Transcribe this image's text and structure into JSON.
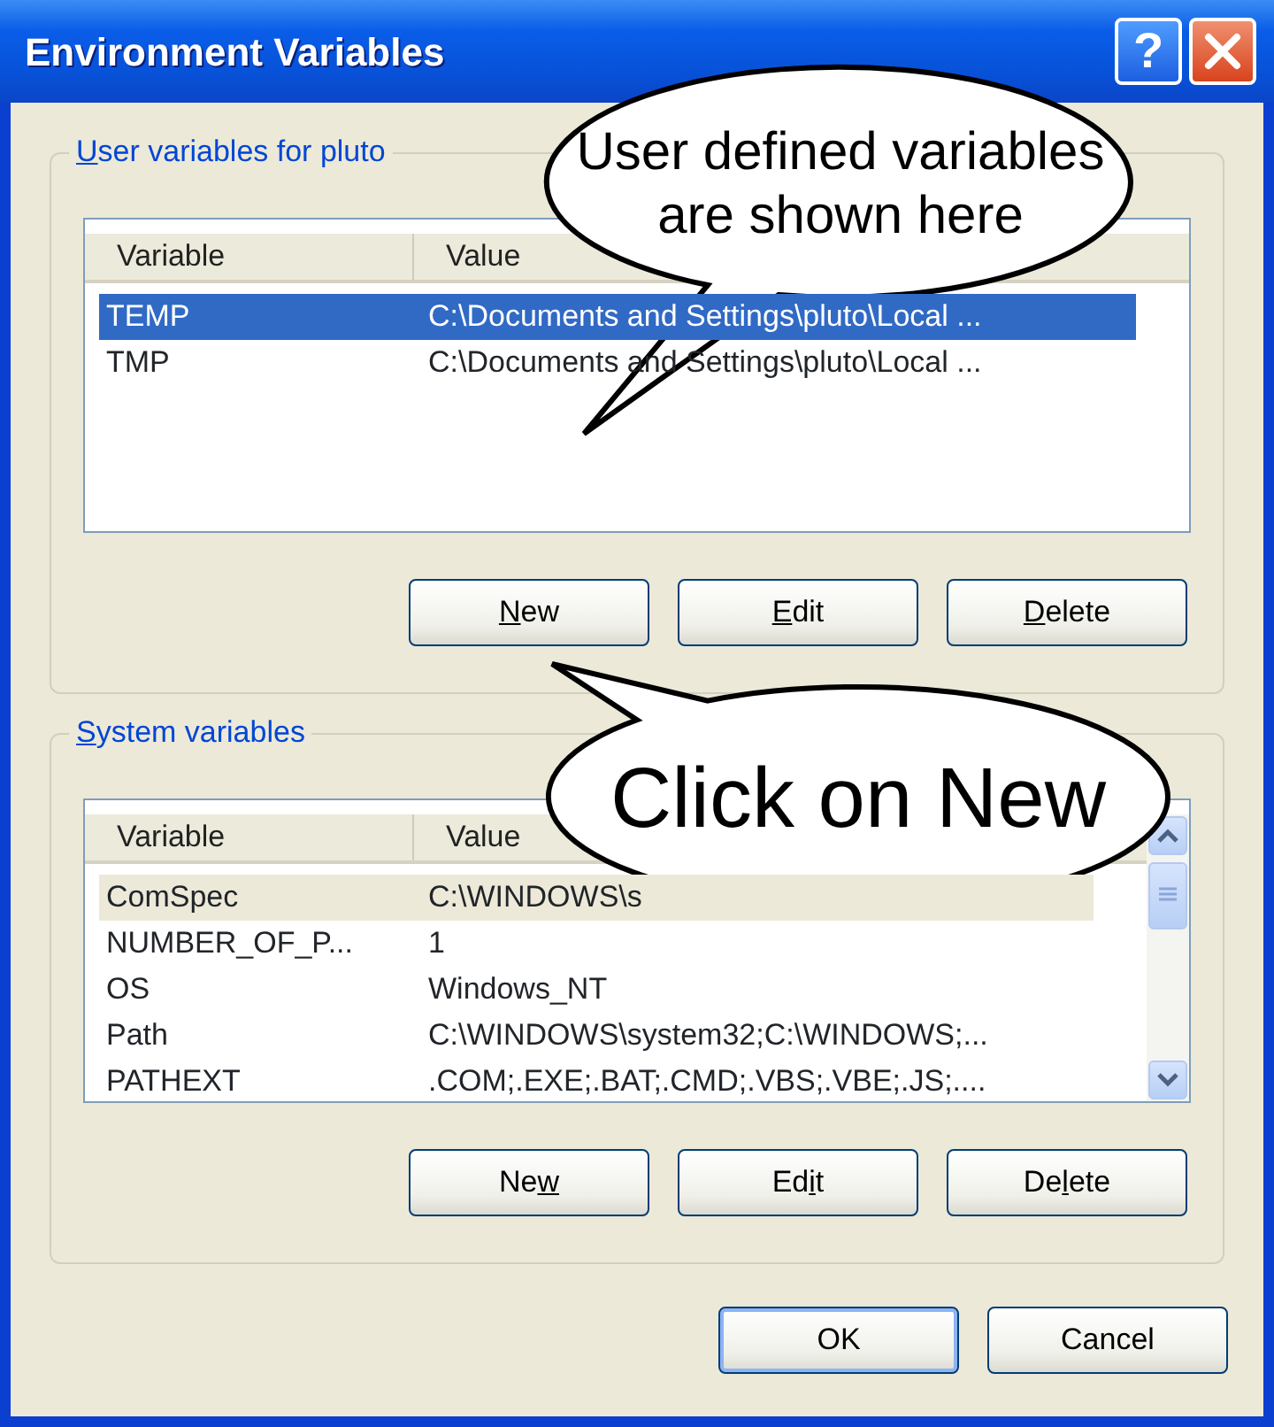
{
  "window": {
    "title": "Environment Variables",
    "title_buttons": [
      {
        "kind": "help",
        "label": "?"
      },
      {
        "kind": "close"
      }
    ]
  },
  "groups": [
    {
      "label": {
        "key": "U",
        "post": "ser variables for pluto"
      },
      "list": {
        "focused": true,
        "scrollbar": false,
        "columns": [
          "Variable",
          "Value"
        ],
        "rows": [
          {
            "variable": "TEMP",
            "value": "C:\\Documents and Settings\\pluto\\Local ...",
            "selected": true
          },
          {
            "variable": "TMP",
            "value": "C:\\Documents and Settings\\pluto\\Local ...",
            "selected": false
          }
        ]
      },
      "buttons": [
        {
          "label": {
            "key": "N",
            "post": "ew"
          }
        },
        {
          "label": {
            "key": "E",
            "post": "dit"
          }
        },
        {
          "label": {
            "key": "D",
            "post": "elete"
          }
        }
      ]
    },
    {
      "label": {
        "key": "S",
        "post": "ystem variables"
      },
      "list": {
        "focused": false,
        "scrollbar": true,
        "columns": [
          "Variable",
          "Value"
        ],
        "rows": [
          {
            "variable": "ComSpec",
            "value": "C:\\WINDOWS\\s",
            "selected": true
          },
          {
            "variable": "NUMBER_OF_P...",
            "value": "1",
            "selected": false
          },
          {
            "variable": "OS",
            "value": "Windows_NT",
            "selected": false
          },
          {
            "variable": "Path",
            "value": "C:\\WINDOWS\\system32;C:\\WINDOWS;...",
            "selected": false
          },
          {
            "variable": "PATHEXT",
            "value": ".COM;.EXE;.BAT;.CMD;.VBS;.VBE;.JS;....",
            "selected": false
          }
        ]
      },
      "buttons": [
        {
          "label": {
            "pre": "Ne",
            "key": "w"
          }
        },
        {
          "label": {
            "pre": "Ed",
            "key": "i",
            "post": "t"
          }
        },
        {
          "label": {
            "pre": "De",
            "key": "l",
            "post": "ete"
          }
        }
      ]
    }
  ],
  "dialog_buttons": [
    {
      "label": "OK",
      "default": true
    },
    {
      "label": "Cancel",
      "default": false
    }
  ],
  "callouts": [
    {
      "lines": [
        "User defined variables",
        "are shown here"
      ],
      "large": false
    },
    {
      "lines": [
        "Click on New"
      ],
      "large": true
    }
  ]
}
